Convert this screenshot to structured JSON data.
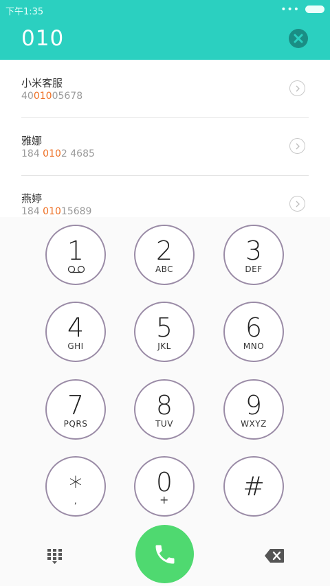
{
  "status_bar": {
    "time": "下午1:35",
    "more": "•••"
  },
  "header": {
    "dialed_number": "010"
  },
  "contacts": [
    {
      "name": "小米客服",
      "num_pre": "40",
      "num_hl": "010",
      "num_post": "05678"
    },
    {
      "name": "雅娜",
      "num_pre": "184 ",
      "num_hl": "010",
      "num_post": "2 4685"
    },
    {
      "name": "燕婷",
      "num_pre": "184 ",
      "num_hl": "010",
      "num_post": "15689"
    }
  ],
  "keypad": [
    {
      "digit": "1",
      "letters": ""
    },
    {
      "digit": "2",
      "letters": "ABC"
    },
    {
      "digit": "3",
      "letters": "DEF"
    },
    {
      "digit": "4",
      "letters": "GHI"
    },
    {
      "digit": "5",
      "letters": "JKL"
    },
    {
      "digit": "6",
      "letters": "MNO"
    },
    {
      "digit": "7",
      "letters": "PQRS"
    },
    {
      "digit": "8",
      "letters": "TUV"
    },
    {
      "digit": "9",
      "letters": "WXYZ"
    },
    {
      "digit": "*",
      "letters": ","
    },
    {
      "digit": "0",
      "letters": "+"
    },
    {
      "digit": "#",
      "letters": ""
    }
  ],
  "colors": {
    "accent": "#2bd0c0",
    "highlight": "#ee6f23",
    "call": "#4fd970",
    "key_border": "#9a8ba6"
  },
  "icons": {
    "clear": "close-circle-icon",
    "arrow": "chevron-right-icon",
    "voicemail": "voicemail-icon",
    "dialpad": "dialpad-icon",
    "call": "phone-icon",
    "backspace": "backspace-icon"
  }
}
